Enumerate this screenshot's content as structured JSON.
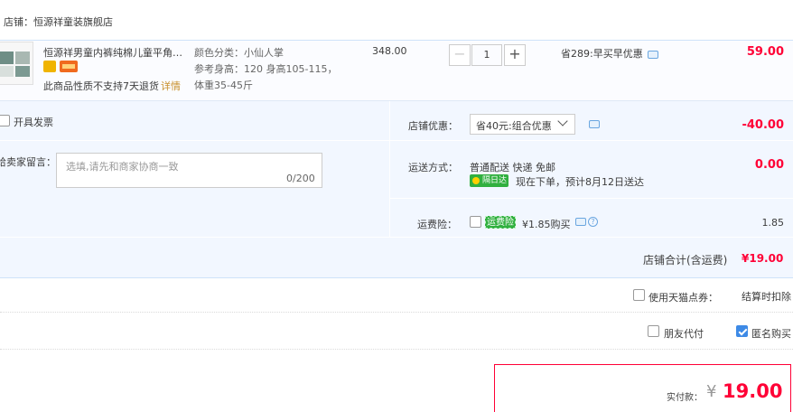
{
  "store": {
    "name": "店铺：恒源祥童装旗舰店"
  },
  "item": {
    "title": "恒源祥男童内裤纯棉儿童平角内...",
    "no_return_text": "此商品性质不支持7天退货",
    "detail_link": "详情",
    "attr_color": "颜色分类：小仙人掌",
    "attr_height": "参考身高：120 身高105-115，",
    "attr_weight": "体重35-45斤",
    "price": "348.00",
    "quantity": "1",
    "qty_minus": "−",
    "qty_plus": "+",
    "promo": "省289:早买早优惠",
    "subtotal": "59.00"
  },
  "invoice": {
    "label": "开具发票",
    "checked": false
  },
  "message": {
    "label": "给卖家留言：",
    "placeholder": "选填,请先和商家协商一致",
    "counter": "0/200"
  },
  "store_discount": {
    "label": "店铺优惠：",
    "selected": "省40元:组合优惠",
    "amount": "-40.00"
  },
  "shipping": {
    "label": "运送方式：",
    "method": "普通配送 快递 免邮",
    "badge": "隔日达",
    "eta": "现在下单，预计8月12日送达",
    "fee": "0.00"
  },
  "insurance": {
    "label": "运费险：",
    "tag": "运费险",
    "price_text": "¥1.85购买",
    "help": "?",
    "amount": "1.85",
    "checked": false
  },
  "store_total": {
    "label": "店铺合计(含运费)",
    "value": "¥19.00"
  },
  "tmall_points": {
    "label": "使用天猫点券：",
    "value": "结算时扣除",
    "checked": false
  },
  "friend_pay": {
    "label": "朋友代付",
    "checked": false
  },
  "anonymous": {
    "label": "匿名购买",
    "checked": true
  },
  "payment": {
    "label": "实付款：",
    "yen": "¥",
    "amount": "19.00"
  },
  "colors": {
    "accent": "#ff0036",
    "panel": "#f2f7ff",
    "border": "#cfe3f9",
    "green": "#31b03f"
  }
}
